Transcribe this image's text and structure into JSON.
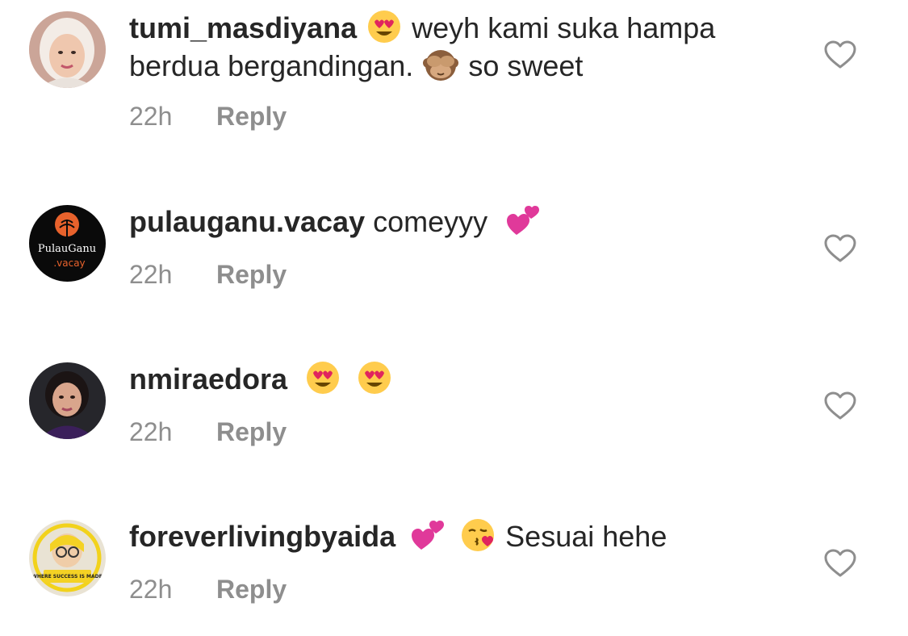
{
  "comments": [
    {
      "username": "tumi_masdiyana",
      "text_before": "weyh kami suka hampa berdua bergandingan.",
      "text_after": "so sweet",
      "time": "22h",
      "reply_label": "Reply"
    },
    {
      "username": "pulauganu.vacay",
      "text": "comeyyy",
      "avatar_logo_text": "PulauGanu",
      "avatar_logo_sub": ".vacay",
      "time": "22h",
      "reply_label": "Reply"
    },
    {
      "username": "nmiraedora",
      "time": "22h",
      "reply_label": "Reply"
    },
    {
      "username": "foreverlivingbyaida",
      "text": "Sesuai hehe",
      "avatar_badge_text": "WHERE SUCCESS IS MADE",
      "time": "22h",
      "reply_label": "Reply"
    }
  ],
  "icons": {
    "like": "heart-outline-icon",
    "emoji_love": "heart-eyes-emoji",
    "emoji_monkey": "see-no-evil-monkey-emoji",
    "emoji_hearts": "two-hearts-emoji",
    "emoji_kiss": "kissing-heart-emoji"
  },
  "colors": {
    "text": "#262626",
    "meta": "#8e8e8e",
    "icon": "#8e8e8e"
  }
}
